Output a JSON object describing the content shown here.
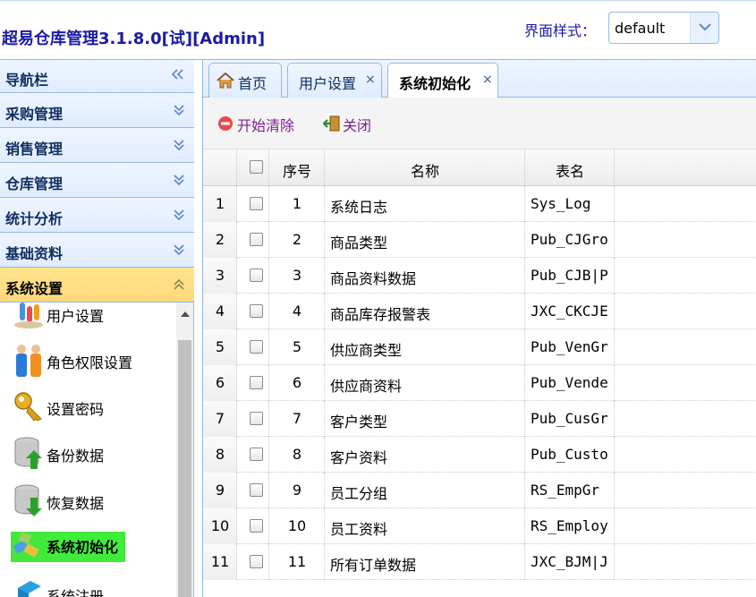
{
  "header": {
    "app_title": "超易仓库管理3.1.8.0[试][Admin]",
    "theme_label": "界面样式：",
    "theme_value": "default"
  },
  "sidebar": {
    "title": "导航栏",
    "sections": [
      {
        "label": "采购管理"
      },
      {
        "label": "销售管理"
      },
      {
        "label": "仓库管理"
      },
      {
        "label": "统计分析"
      },
      {
        "label": "基础资料"
      },
      {
        "label": "系统设置",
        "selected": true
      }
    ],
    "items": [
      {
        "label": "用户设置",
        "icon": "users-icon"
      },
      {
        "label": "角色权限设置",
        "icon": "roles-icon"
      },
      {
        "label": "设置密码",
        "icon": "key-icon"
      },
      {
        "label": "备份数据",
        "icon": "database-upload-icon"
      },
      {
        "label": "恢复数据",
        "icon": "database-download-icon"
      },
      {
        "label": "系统初始化",
        "icon": "system-init-icon",
        "active": true
      },
      {
        "label": "系统注册",
        "icon": "register-icon"
      }
    ]
  },
  "tabs": [
    {
      "label": "首页",
      "icon": "home-icon"
    },
    {
      "label": "用户设置",
      "close": "×"
    },
    {
      "label": "系统初始化",
      "close": "×",
      "active": true
    }
  ],
  "toolbar": {
    "clear_label": "开始清除",
    "close_label": "关闭"
  },
  "grid": {
    "columns": [
      "序号",
      "名称",
      "表名"
    ],
    "rows": [
      {
        "n": "1",
        "seq": "1",
        "name": "系统日志",
        "table": "Sys_Log"
      },
      {
        "n": "2",
        "seq": "2",
        "name": "商品类型",
        "table": "Pub_CJGro"
      },
      {
        "n": "3",
        "seq": "3",
        "name": "商品资料数据",
        "table": "Pub_CJB|P"
      },
      {
        "n": "4",
        "seq": "4",
        "name": "商品库存报警表",
        "table": "JXC_CKCJE"
      },
      {
        "n": "5",
        "seq": "5",
        "name": "供应商类型",
        "table": "Pub_VenGr"
      },
      {
        "n": "6",
        "seq": "6",
        "name": "供应商资料",
        "table": "Pub_Vende"
      },
      {
        "n": "7",
        "seq": "7",
        "name": "客户类型",
        "table": "Pub_CusGr"
      },
      {
        "n": "8",
        "seq": "8",
        "name": "客户资料",
        "table": "Pub_Custo"
      },
      {
        "n": "9",
        "seq": "9",
        "name": "员工分组",
        "table": "RS_EmpGr"
      },
      {
        "n": "10",
        "seq": "10",
        "name": "员工资料",
        "table": "RS_Employ"
      },
      {
        "n": "11",
        "seq": "11",
        "name": "所有订单数据",
        "table": "JXC_BJM|J"
      }
    ]
  },
  "colors": {
    "accent_border": "#95B8E7",
    "header_text": "#1a1aa6",
    "selected_section": "#ffe48d",
    "active_item": "#42e83a",
    "toolbar_text": "#7a1f8c"
  }
}
